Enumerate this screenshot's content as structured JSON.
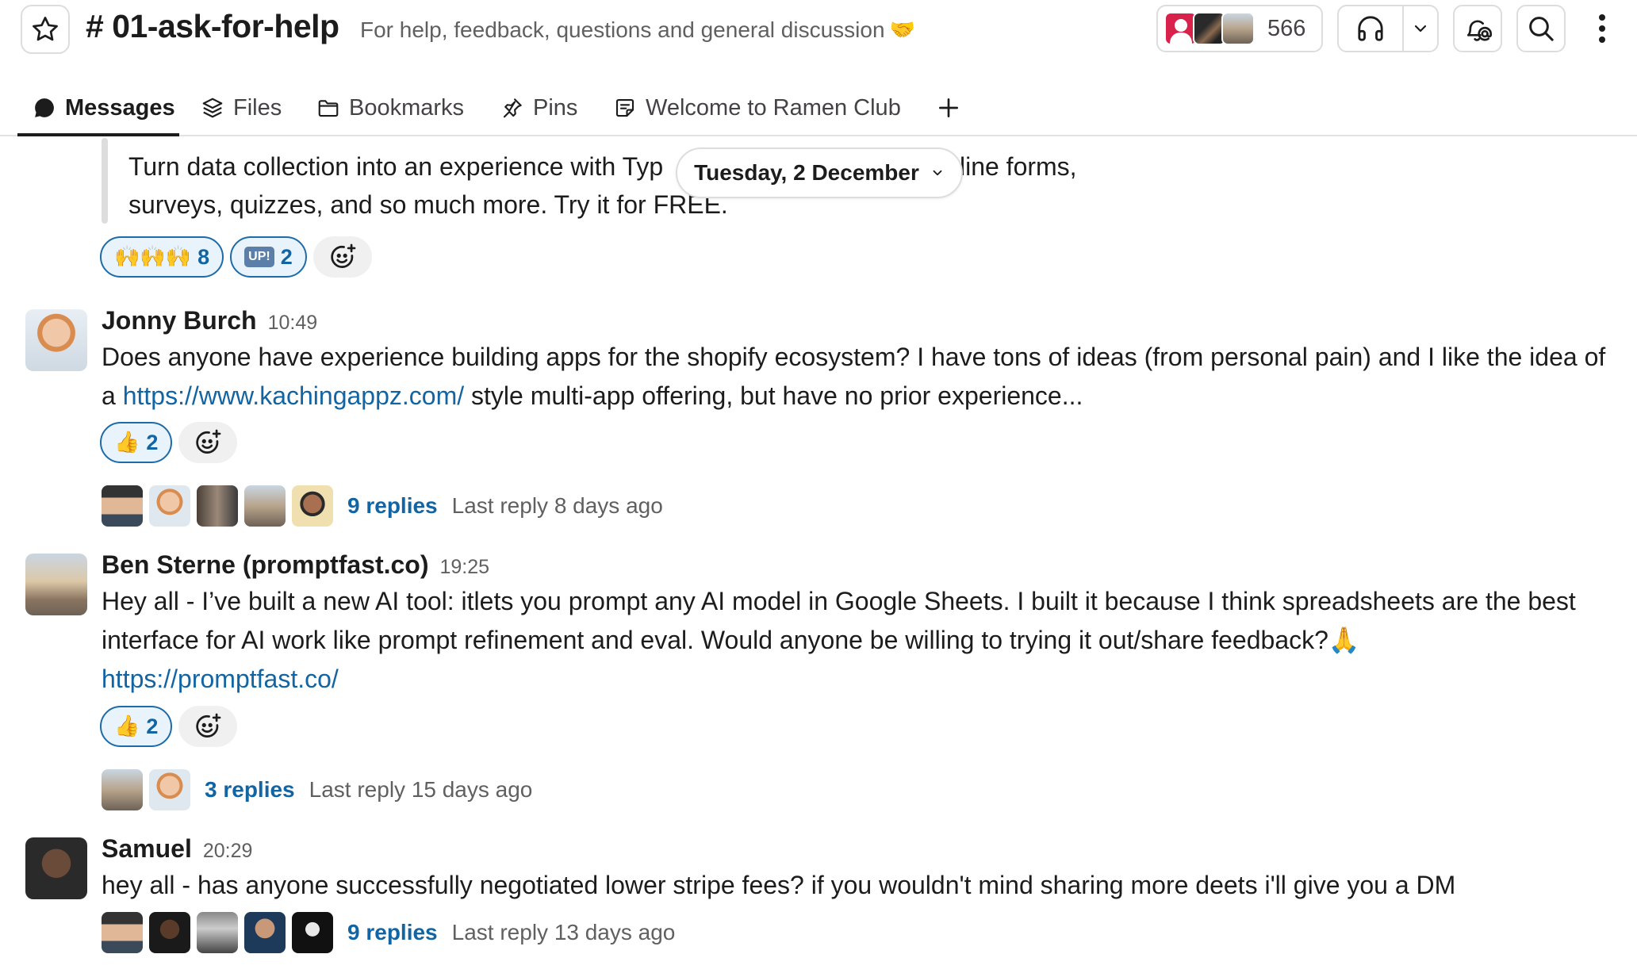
{
  "channel": {
    "name": "# 01-ask-for-help",
    "topic": "For help, feedback, questions and general discussion",
    "topic_emoji": "🤝",
    "member_count": "566"
  },
  "tabs": [
    {
      "label": "Messages",
      "icon": "chat-bubble-icon",
      "active": true
    },
    {
      "label": "Files",
      "icon": "layers-icon"
    },
    {
      "label": "Bookmarks",
      "icon": "folder-icon"
    },
    {
      "label": "Pins",
      "icon": "pin-icon"
    },
    {
      "label": "Welcome to Ramen Club",
      "icon": "canvas-icon"
    }
  ],
  "date_divider": "Tuesday, 2 December",
  "previous_unfurl": {
    "line1": "Turn data collection into an experience with Typ",
    "line1_tail": "nline forms,",
    "line2": "surveys, quizzes, and so much more. Try it for FREE."
  },
  "previous_reactions": [
    {
      "emoji": "🙌🙌🙌",
      "count": "8"
    },
    {
      "emoji": "UP!",
      "count": "2"
    }
  ],
  "messages": [
    {
      "author": "Jonny Burch",
      "time": "10:49",
      "text_before": "Does anyone have experience building apps for the shopify ecosystem? I have tons of ideas (from personal pain) and I like the idea of a ",
      "link": "https://www.kachingappz.com/",
      "text_after": " style multi-app offering, but have no prior experience...",
      "reaction": {
        "emoji": "👍",
        "count": "2"
      },
      "replies": "9 replies",
      "last_reply": "Last reply 8 days ago"
    },
    {
      "author": "Ben Sterne (promptfast.co)",
      "time": "19:25",
      "text": "Hey all - I’ve built a new AI tool: itlets you prompt any AI model in Google Sheets. I built it because I think spreadsheets are the best interface for AI work like prompt refinement and eval. Would anyone be willing to trying it out/share feedback?",
      "emoji": "🙏",
      "link": "https://promptfast.co/",
      "reaction": {
        "emoji": "👍",
        "count": "2"
      },
      "replies": "3 replies",
      "last_reply": "Last reply 15 days ago"
    },
    {
      "author": "Samuel",
      "time": "20:29",
      "text": "hey all - has anyone successfully negotiated lower stripe fees? if you wouldn't mind sharing more deets i'll give you a DM",
      "replies": "9 replies",
      "last_reply": "Last reply 13 days ago"
    }
  ],
  "colors": {
    "link": "#1264a3",
    "reaction_border": "#1d6ba8",
    "reaction_bg": "#e8f3fb",
    "muted": "#616061"
  }
}
